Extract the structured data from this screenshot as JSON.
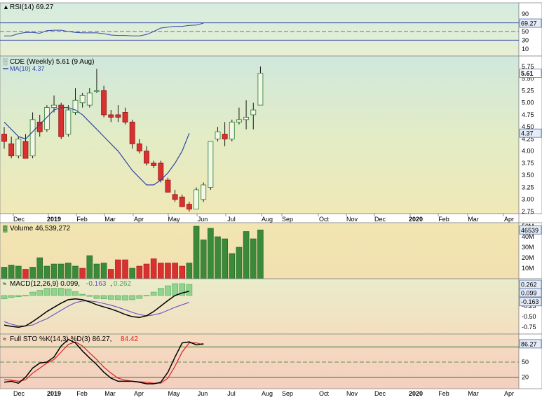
{
  "colors": {
    "up": "#3a8a3a",
    "down": "#d93030",
    "ma": "#3246a6",
    "rsi": "#3246a6",
    "signal": "#6b52c8",
    "stoD": "#e0201e",
    "line": "#000000",
    "hist": "#8fd48f",
    "tag": "#e4ecf7"
  },
  "months": [
    "Dec",
    "2019",
    "Feb",
    "Mar",
    "Apr",
    "May",
    "Jun",
    "Jul",
    "Aug",
    "Sep",
    "Oct",
    "Nov",
    "Dec",
    "2020",
    "Feb",
    "Mar",
    "Apr"
  ],
  "chart_data": [
    {
      "type": "line",
      "title": "RSI(14) 69.27",
      "series": [
        {
          "name": "RSI(14)",
          "values": [
            40,
            40,
            45,
            48,
            48,
            46,
            52,
            53,
            53,
            50,
            48,
            47,
            47,
            47,
            45,
            42,
            41,
            41,
            40,
            40,
            43,
            50,
            58,
            60,
            62,
            62,
            64,
            65,
            69.27
          ]
        }
      ],
      "ylim": [
        0,
        100
      ],
      "ticks": [
        "90",
        "50",
        "30",
        "10"
      ],
      "levels": [
        70,
        50,
        30
      ],
      "last_value": "69.27"
    },
    {
      "type": "candlestick",
      "title": "CDE (Weekly) 5.61 (9 Aug)",
      "ma_label": "MA(10) 4.37",
      "ylim": [
        2.75,
        5.85
      ],
      "ticks": [
        "5.75",
        "5.50",
        "5.25",
        "5.00",
        "4.75",
        "4.50",
        "4.25",
        "4.00",
        "3.75",
        "3.50",
        "3.25",
        "3.00",
        "2.75"
      ],
      "last_price": "5.61",
      "last_ma": "4.37",
      "ohlc": [
        [
          4.35,
          4.5,
          4.05,
          4.2
        ],
        [
          4.15,
          4.3,
          3.85,
          3.9
        ],
        [
          3.9,
          4.3,
          3.85,
          4.25
        ],
        [
          4.2,
          4.35,
          3.85,
          3.85
        ],
        [
          3.9,
          4.8,
          3.85,
          4.65
        ],
        [
          4.6,
          4.75,
          4.3,
          4.4
        ],
        [
          4.45,
          4.95,
          4.4,
          4.9
        ],
        [
          4.9,
          5.15,
          4.8,
          4.95
        ],
        [
          4.95,
          5.0,
          4.25,
          4.3
        ],
        [
          4.35,
          4.95,
          4.3,
          4.85
        ],
        [
          4.8,
          5.3,
          4.75,
          5.05
        ],
        [
          5.0,
          5.2,
          4.9,
          5.15
        ],
        [
          4.95,
          5.3,
          4.9,
          5.2
        ],
        [
          5.25,
          5.7,
          5.2,
          5.25
        ],
        [
          5.25,
          5.35,
          4.7,
          4.75
        ],
        [
          4.75,
          4.85,
          4.6,
          4.7
        ],
        [
          4.75,
          4.95,
          4.6,
          4.7
        ],
        [
          4.8,
          4.9,
          4.55,
          4.6
        ],
        [
          4.6,
          4.65,
          4.05,
          4.15
        ],
        [
          4.15,
          4.25,
          3.95,
          4.0
        ],
        [
          4.0,
          4.1,
          3.7,
          3.75
        ],
        [
          3.75,
          3.8,
          3.65,
          3.7
        ],
        [
          3.75,
          3.8,
          3.35,
          3.4
        ],
        [
          3.4,
          3.45,
          3.15,
          3.15
        ],
        [
          3.1,
          3.2,
          2.95,
          3.0
        ],
        [
          3.05,
          3.1,
          2.85,
          2.85
        ],
        [
          2.9,
          2.95,
          2.75,
          2.8
        ],
        [
          2.8,
          3.25,
          2.8,
          3.2
        ],
        [
          3.0,
          3.35,
          2.95,
          3.3
        ],
        [
          3.25,
          4.2,
          3.2,
          4.2
        ],
        [
          4.25,
          4.5,
          4.2,
          4.4
        ],
        [
          4.35,
          4.6,
          4.1,
          4.25
        ],
        [
          4.25,
          4.65,
          4.2,
          4.6
        ],
        [
          4.6,
          4.9,
          4.55,
          4.65
        ],
        [
          4.65,
          5.05,
          4.45,
          4.7
        ],
        [
          4.75,
          5.0,
          4.45,
          4.85
        ],
        [
          4.95,
          5.75,
          4.95,
          5.61
        ]
      ],
      "ma": [
        4.6,
        4.45,
        4.3,
        4.25,
        4.4,
        4.55,
        4.7,
        4.85,
        4.9,
        4.9,
        4.85,
        4.75,
        4.6,
        4.45,
        4.3,
        4.15,
        4.0,
        3.8,
        3.6,
        3.45,
        3.3,
        3.3,
        3.4,
        3.55,
        3.75,
        4.0,
        4.37
      ]
    },
    {
      "type": "bar",
      "title": "Volume 46,539,272",
      "ylim": [
        0,
        50
      ],
      "ticks": [
        "50M",
        "40M",
        "30M",
        "20M",
        "10M"
      ],
      "last_value": "46539",
      "values": [
        11,
        13,
        12,
        9,
        11,
        20,
        12,
        14,
        14,
        15,
        12,
        10,
        22,
        14,
        15,
        9,
        18,
        18,
        10,
        12,
        14,
        19,
        15,
        15,
        15,
        12,
        15,
        50,
        37,
        48,
        40,
        38,
        24,
        30,
        45,
        38,
        46.5
      ],
      "up": [
        1,
        1,
        1,
        0,
        1,
        1,
        1,
        1,
        1,
        1,
        1,
        0,
        1,
        1,
        1,
        0,
        0,
        0,
        1,
        0,
        0,
        0,
        0,
        0,
        0,
        0,
        1,
        1,
        1,
        1,
        1,
        1,
        1,
        1,
        1,
        1,
        1
      ]
    },
    {
      "type": "line",
      "title": "MACD(12,26,9) 0.099, -0.163, 0.262",
      "series": [
        {
          "name": "MACD",
          "values": [
            -0.7,
            -0.73,
            -0.75,
            -0.72,
            -0.62,
            -0.5,
            -0.38,
            -0.28,
            -0.18,
            -0.1,
            -0.08,
            -0.1,
            -0.15,
            -0.22,
            -0.27,
            -0.32,
            -0.38,
            -0.45,
            -0.5,
            -0.52,
            -0.48,
            -0.38,
            -0.25,
            -0.12,
            0.0,
            0.06,
            0.099
          ]
        },
        {
          "name": "Signal",
          "values": [
            -0.62,
            -0.68,
            -0.72,
            -0.72,
            -0.7,
            -0.62,
            -0.55,
            -0.45,
            -0.35,
            -0.25,
            -0.17,
            -0.13,
            -0.13,
            -0.15,
            -0.19,
            -0.23,
            -0.28,
            -0.34,
            -0.4,
            -0.45,
            -0.48,
            -0.46,
            -0.42,
            -0.35,
            -0.28,
            -0.22,
            -0.163
          ]
        }
      ],
      "histogram": [
        -0.08,
        -0.05,
        -0.03,
        0.0,
        0.08,
        0.12,
        0.17,
        0.17,
        0.17,
        0.15,
        0.09,
        0.03,
        -0.02,
        -0.07,
        -0.08,
        -0.09,
        -0.1,
        -0.11,
        -0.1,
        -0.07,
        0.0,
        0.08,
        0.17,
        0.23,
        0.28,
        0.28,
        0.262
      ],
      "ylim": [
        -0.88,
        0.33
      ],
      "ticks": [
        "0.25",
        "-0.25",
        "-0.50",
        "-0.75"
      ],
      "last_values": [
        "0.262",
        "0.099",
        "-0.163"
      ]
    },
    {
      "type": "line",
      "title": "Full STO %K(14,3) %D(3) 86.27, 84.42",
      "series": [
        {
          "name": "%K",
          "values": [
            10,
            12,
            8,
            20,
            38,
            48,
            50,
            60,
            82,
            95,
            88,
            72,
            58,
            45,
            30,
            18,
            12,
            12,
            12,
            10,
            7,
            7,
            10,
            30,
            60,
            88,
            90,
            84,
            86.27
          ]
        },
        {
          "name": "%D",
          "values": [
            15,
            14,
            12,
            15,
            28,
            38,
            48,
            55,
            70,
            85,
            90,
            82,
            68,
            55,
            40,
            28,
            18,
            14,
            12,
            11,
            10,
            8,
            8,
            18,
            42,
            70,
            88,
            88,
            84.42
          ]
        }
      ],
      "ylim": [
        0,
        100
      ],
      "ticks": [
        "50",
        "20"
      ],
      "levels": [
        80,
        50,
        20
      ],
      "last_value": "86.27"
    }
  ]
}
